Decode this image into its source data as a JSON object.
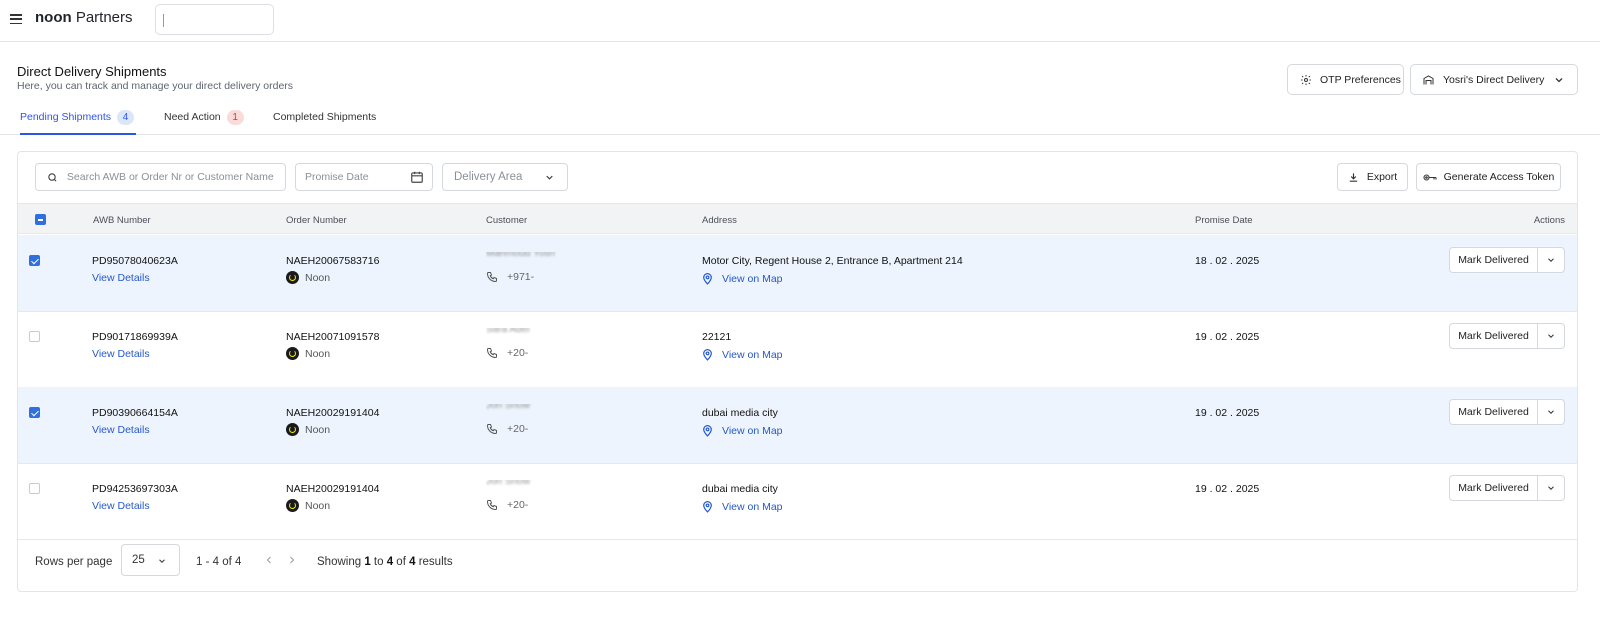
{
  "app": {
    "brand_bold": "noon",
    "brand_rest": "Partners"
  },
  "header": {
    "title": "Direct Delivery Shipments",
    "subtitle": "Here, you can track and manage your direct delivery orders",
    "otp_button": "OTP Preferences",
    "store_selector": "Yosri's Direct Delivery"
  },
  "tabs": [
    {
      "label": "Pending Shipments",
      "count": "4"
    },
    {
      "label": "Need Action",
      "count": "1"
    },
    {
      "label": "Completed Shipments"
    }
  ],
  "filters": {
    "search_placeholder": "Search AWB or Order Nr or Customer Name",
    "promise_date_placeholder": "Promise Date",
    "delivery_area_placeholder": "Delivery Area",
    "export_label": "Export",
    "token_label": "Generate Access Token"
  },
  "table": {
    "columns": [
      "AWB Number",
      "Order Number",
      "Customer",
      "Address",
      "Promise Date",
      "Actions"
    ],
    "view_details_label": "View Details",
    "view_map_label": "View on Map",
    "mark_delivered_label": "Mark Delivered",
    "rows": [
      {
        "selected": true,
        "awb": "PD95078040623A",
        "order": "NAEH20067583716",
        "seller": "Noon",
        "customer": "Mahmoud Yosri",
        "phone": "+971-",
        "address": "Motor City, Regent House 2, Entrance B, Apartment 214",
        "promise_date": "18 . 02 . 2025"
      },
      {
        "selected": false,
        "awb": "PD90171869939A",
        "order": "NAEH20071091578",
        "seller": "Noon",
        "customer": "Sara Adel",
        "phone": "+20-",
        "address": "22121",
        "promise_date": "19 . 02 . 2025"
      },
      {
        "selected": true,
        "awb": "PD90390664154A",
        "order": "NAEH20029191404",
        "seller": "Noon",
        "customer": "Jon Snow",
        "phone": "+20-",
        "address": "dubai media city",
        "promise_date": "19 . 02 . 2025"
      },
      {
        "selected": false,
        "awb": "PD94253697303A",
        "order": "NAEH20029191404",
        "seller": "Noon",
        "customer": "Jon Snow",
        "phone": "+20-",
        "address": "dubai media city",
        "promise_date": "19 . 02 . 2025"
      }
    ]
  },
  "pagination": {
    "rows_label": "Rows per page",
    "rows_value": "25",
    "range": "1 - 4 of 4",
    "showing_prefix": "Showing ",
    "showing_from": "1",
    "showing_mid": " to ",
    "showing_to": "4",
    "showing_of": " of ",
    "showing_total": "4",
    "showing_suffix": " results"
  },
  "colors": {
    "accent": "#2f54eb",
    "link": "#2559c7",
    "selected_row": "#eef4fd",
    "checkbox": "#2f6fde"
  }
}
